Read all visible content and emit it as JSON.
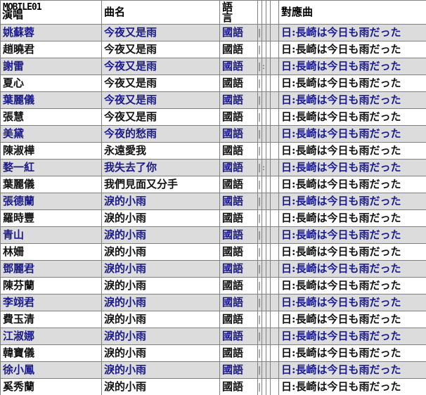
{
  "header": {
    "logo_text": "MOBILE01",
    "singer": "演唱",
    "song": "曲名",
    "lang": "語言",
    "match": "對應曲"
  },
  "rows": [
    {
      "singer": "姚蘇蓉",
      "song": "今夜又是雨",
      "lang": "國語",
      "mark1": "|",
      "match": "日:長崎は今日も雨だった"
    },
    {
      "singer": "趙曉君",
      "song": "今夜又是雨",
      "lang": "國語",
      "mark1": "|",
      "match": "日:長崎は今日も雨だった"
    },
    {
      "singer": "謝雷",
      "song": "今夜又是雨",
      "lang": "國語",
      "mark1": "|",
      "mark2": ":",
      "match": "日:長崎は今日も雨だった"
    },
    {
      "singer": "夏心",
      "song": "今夜又是雨",
      "lang": "國語",
      "mark1": "|",
      "match": "日:長崎は今日も雨だった"
    },
    {
      "singer": "葉麗儀",
      "song": "今夜又是雨",
      "lang": "國語",
      "mark1": "|",
      "match": "日:長崎は今日も雨だった"
    },
    {
      "singer": "張慧",
      "song": "今夜又是雨",
      "lang": "國語",
      "mark1": "|",
      "match": "日:長崎は今日も雨だった"
    },
    {
      "singer": "美黛",
      "song": "今夜的愁雨",
      "lang": "國語",
      "mark1": "|",
      "match": "日:長崎は今日も雨だった"
    },
    {
      "singer": "陳淑樺",
      "song": "永遠愛我",
      "lang": "國語",
      "mark1": "|",
      "match": "日:長崎は今日も雨だった"
    },
    {
      "singer": "婺一紅",
      "song": "我失去了你",
      "lang": "國語",
      "mark1": "|",
      "mark2": ":",
      "match": "日:長崎は今日も雨だった"
    },
    {
      "singer": "葉麗儀",
      "song": "我們見面又分手",
      "lang": "國語",
      "mark1": "|",
      "match": "日:長崎は今日も雨だった"
    },
    {
      "singer": "張德蘭",
      "song": "淚的小雨",
      "lang": "國語",
      "mark1": "|",
      "match": "日:長崎は今日も雨だった"
    },
    {
      "singer": "羅時豐",
      "song": "淚的小雨",
      "lang": "國語",
      "mark1": "|",
      "match": "日:長崎は今日も雨だった"
    },
    {
      "singer": "青山",
      "song": "淚的小雨",
      "lang": "國語",
      "mark1": "|",
      "match": "日:長崎は今日も雨だった"
    },
    {
      "singer": "林姍",
      "song": "淚的小雨",
      "lang": "國語",
      "mark1": "|",
      "match": "日:長崎は今日も雨だった"
    },
    {
      "singer": "鄧麗君",
      "song": "淚的小雨",
      "lang": "國語",
      "mark1": "|",
      "match": "日:長崎は今日も雨だった"
    },
    {
      "singer": "陳芬蘭",
      "song": "淚的小雨",
      "lang": "國語",
      "mark1": "|",
      "match": "日:長崎は今日も雨だった"
    },
    {
      "singer": "李翊君",
      "song": "淚的小雨",
      "lang": "國語",
      "mark1": "|",
      "match": "日:長崎は今日も雨だった"
    },
    {
      "singer": "費玉清",
      "song": "淚的小雨",
      "lang": "國語",
      "mark1": "|",
      "match": "日:長崎は今日も雨だった"
    },
    {
      "singer": "江淑娜",
      "song": "淚的小雨",
      "lang": "國語",
      "mark1": "|",
      "match": "日:長崎は今日も雨だった"
    },
    {
      "singer": "韓寶儀",
      "song": "淚的小雨",
      "lang": "國語",
      "mark1": "|",
      "match": "日:長崎は今日も雨だった"
    },
    {
      "singer": "徐小鳳",
      "song": "淚的小雨",
      "lang": "國語",
      "mark1": "|",
      "match": "日:長崎は今日も雨だった"
    },
    {
      "singer": "奚秀蘭",
      "song": "淚的小雨",
      "lang": "國語",
      "mark1": "|",
      "match": "日:長崎は今日も雨だった"
    }
  ]
}
